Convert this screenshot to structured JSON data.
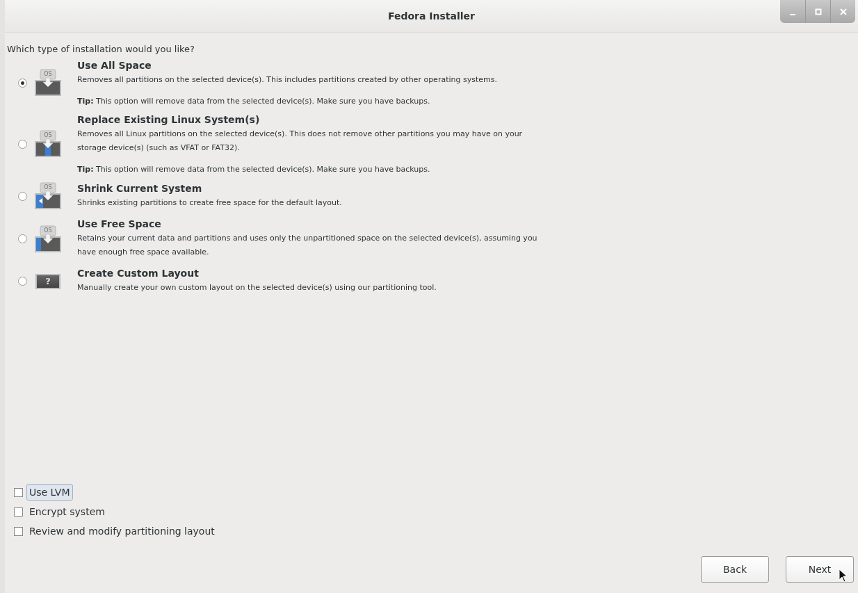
{
  "window": {
    "title": "Fedora Installer"
  },
  "question": "Which type of installation would you like?",
  "options": [
    {
      "kind": "all",
      "selected": true,
      "icon_label": "OS",
      "title": "Use All Space",
      "description": "Removes all partitions on the selected device(s).  This includes partitions created by other operating systems.",
      "tip_label": "Tip:",
      "tip": "This option will remove data from the selected device(s).  Make sure you have backups."
    },
    {
      "kind": "replace",
      "selected": false,
      "icon_label": "OS",
      "title": "Replace Existing Linux System(s)",
      "description": "Removes all Linux partitions on the selected device(s). This does not remove other partitions you may have on your storage device(s) (such as VFAT or FAT32).",
      "tip_label": "Tip:",
      "tip": "This option will remove data from the selected device(s).  Make sure you have backups."
    },
    {
      "kind": "shrink",
      "selected": false,
      "icon_label": "OS",
      "title": "Shrink Current System",
      "description": "Shrinks existing partitions to create free space for the default layout."
    },
    {
      "kind": "free",
      "selected": false,
      "icon_label": "OS",
      "title": "Use Free Space",
      "description": "Retains your current data and partitions and uses only the unpartitioned space on the selected device(s), assuming you have enough free space available."
    },
    {
      "kind": "custom",
      "selected": false,
      "title": "Create Custom Layout",
      "description": "Manually create your own custom layout on the selected device(s) using our partitioning tool.",
      "icon_text": "?"
    }
  ],
  "checkboxes": [
    {
      "label": "Use LVM",
      "checked": false,
      "focused": true
    },
    {
      "label": "Encrypt system",
      "checked": false,
      "focused": false
    },
    {
      "label": "Review and modify partitioning layout",
      "checked": false,
      "focused": false
    }
  ],
  "buttons": [
    "Back",
    "Next"
  ]
}
